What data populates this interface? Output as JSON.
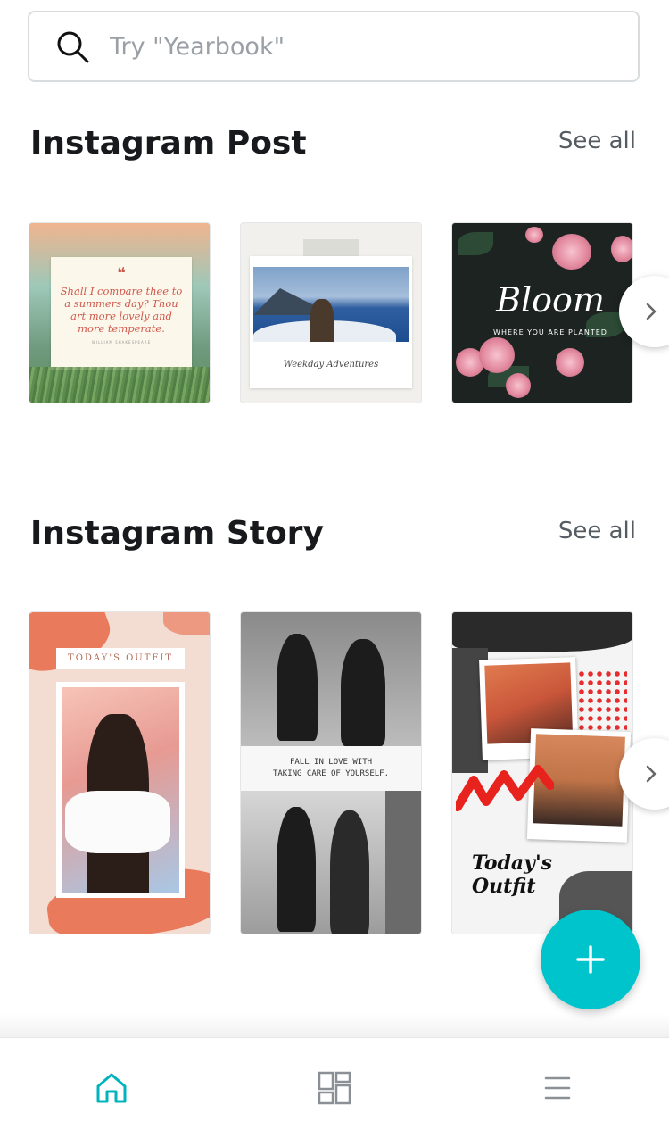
{
  "search": {
    "placeholder": "Try \"Yearbook\"",
    "icon": "search-icon"
  },
  "sections": [
    {
      "title": "Instagram Post",
      "see_all": "See all",
      "templates": [
        {
          "kind": "quote",
          "quote_mark": "❝",
          "text": "Shall I compare thee to a summers day? Thou art more lovely and more temperate.",
          "author": "WILLIAM SHAKESPEARE"
        },
        {
          "kind": "photo",
          "caption": "Weekday Adventures"
        },
        {
          "kind": "bloom",
          "title": "Bloom",
          "subtitle": "WHERE YOU ARE PLANTED"
        }
      ]
    },
    {
      "title": "Instagram Story",
      "see_all": "See all",
      "templates": [
        {
          "kind": "outfit",
          "label": "TODAY'S OUTFIT"
        },
        {
          "kind": "fitness",
          "text_line1": "FALL IN LOVE WITH",
          "text_line2": "TAKING CARE OF YOURSELF."
        },
        {
          "kind": "collage",
          "title_line1": "Today's",
          "title_line2": "Outfit"
        }
      ]
    }
  ],
  "fab": {
    "icon": "plus-icon"
  },
  "bottom_nav": [
    {
      "name": "home",
      "icon": "home-icon",
      "active": true
    },
    {
      "name": "designs",
      "icon": "grid-icon",
      "active": false
    },
    {
      "name": "menu",
      "icon": "menu-icon",
      "active": false
    }
  ],
  "colors": {
    "accent": "#00c4cc",
    "nav_active": "#00b3bd",
    "nav_inactive": "#8a9096"
  }
}
